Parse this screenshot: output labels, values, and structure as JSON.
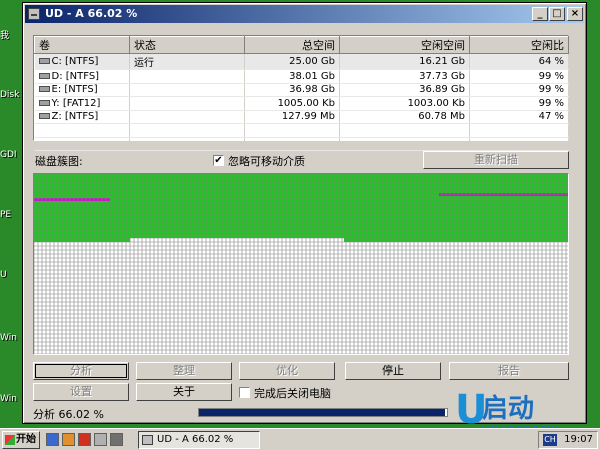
{
  "desktop": {
    "labels": [
      "我",
      "Disk",
      "GDI",
      "PE",
      "U",
      "Win",
      "Win"
    ]
  },
  "window": {
    "title": "UD - A 66.02 %",
    "minimize": "_",
    "maximize": "□",
    "close": "×"
  },
  "volume_list": {
    "headers": [
      "卷",
      "状态",
      "总空间",
      "空闲空间",
      "空闲比"
    ],
    "rows": [
      {
        "volume": "C: [NTFS]",
        "status": "运行",
        "total": "25.00 Gb",
        "free": "16.21 Gb",
        "ratio": "64 %",
        "selected": true
      },
      {
        "volume": "D: [NTFS]",
        "status": "",
        "total": "38.01 Gb",
        "free": "37.73 Gb",
        "ratio": "99 %"
      },
      {
        "volume": "E: [NTFS]",
        "status": "",
        "total": "36.98 Gb",
        "free": "36.89 Gb",
        "ratio": "99 %"
      },
      {
        "volume": "Y: [FAT12]",
        "status": "",
        "total": "1005.00 Kb",
        "free": "1003.00 Kb",
        "ratio": "99 %"
      },
      {
        "volume": "Z: [NTFS]",
        "status": "",
        "total": "127.99 Mb",
        "free": "60.78 Mb",
        "ratio": "47 %"
      }
    ]
  },
  "map_section": {
    "label": "磁盘簇图:",
    "ignore_removable_label": "忽略可移动介质",
    "ignore_removable_checked": true,
    "rescan_button": "重新扫描"
  },
  "buttons": {
    "analyze": "分析",
    "defrag": "整理",
    "optimize": "优化",
    "stop": "停止",
    "report": "报告",
    "settings": "设置",
    "about": "关于",
    "shutdown_label": "完成后关闭电脑",
    "shutdown_checked": false
  },
  "status": {
    "text": "分析  66.02 %",
    "progress": 0.99
  },
  "taskbar": {
    "start_label": "开始",
    "task_label": "UD - A 66.02 %",
    "ime_label": "CH",
    "clock": "19:07"
  },
  "logo": {
    "letter": "U",
    "text": "启动",
    "url": "WWW.UQIDONG.COM"
  },
  "colors": {
    "used_cluster": "#1ec81e",
    "free_cluster": "#ffffff",
    "fragmented": "#c814c8",
    "title_start": "#0a246a",
    "title_end": "#a6caf0"
  }
}
